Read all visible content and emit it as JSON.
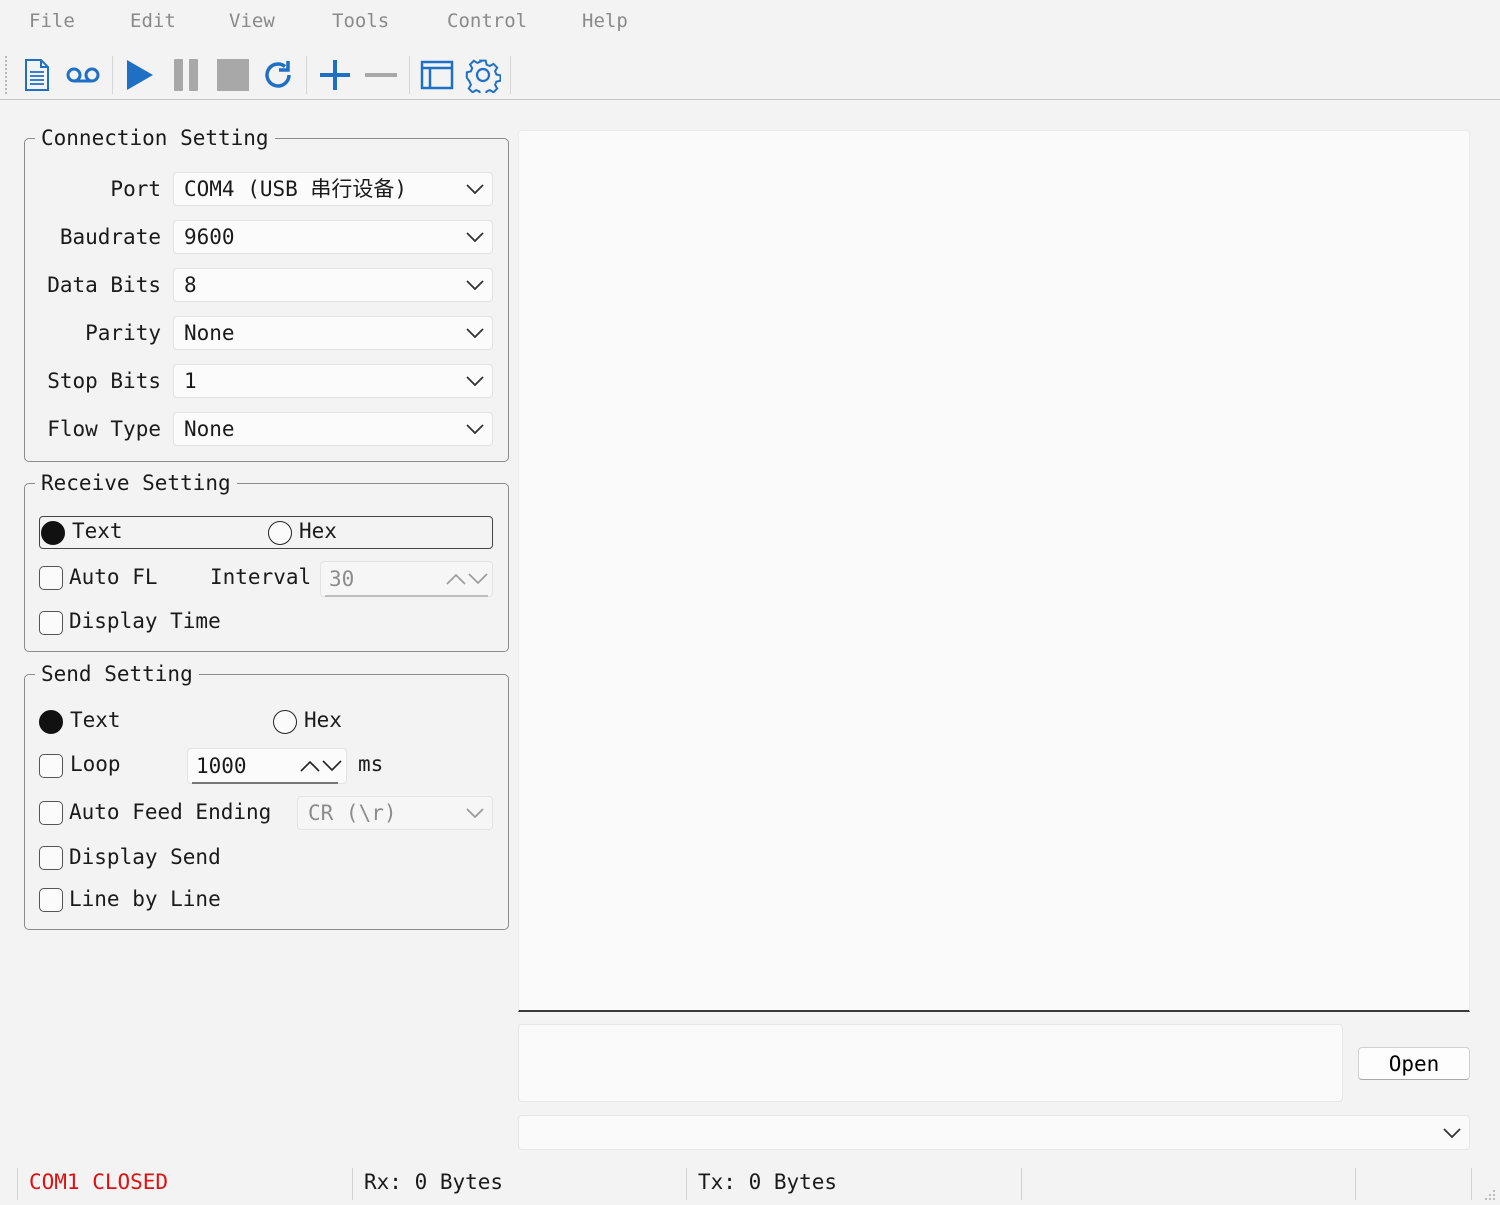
{
  "menu": [
    "File",
    "Edit",
    "View",
    "Tools",
    "Control",
    "Help"
  ],
  "toolbar": {
    "icons": [
      "new-document-icon",
      "voicemail-icon",
      "play-icon",
      "pause-icon",
      "stop-icon",
      "refresh-icon",
      "add-icon",
      "remove-icon",
      "window-icon",
      "settings-icon"
    ],
    "accent": "#1f6fc5"
  },
  "connection": {
    "title": "Connection Setting",
    "port_label": "Port",
    "port_value": "COM4 (USB 串行设备)",
    "baudrate_label": "Baudrate",
    "baudrate_value": "9600",
    "databits_label": "Data Bits",
    "databits_value": "8",
    "parity_label": "Parity",
    "parity_value": "None",
    "stopbits_label": "Stop Bits",
    "stopbits_value": "1",
    "flow_label": "Flow Type",
    "flow_value": "None"
  },
  "receive": {
    "title": "Receive Setting",
    "text_label": "Text",
    "hex_label": "Hex",
    "selected": "Text",
    "autofl_label": "Auto FL",
    "autofl_checked": false,
    "interval_label": "Interval",
    "interval_value": "30",
    "displaytime_label": "Display Time",
    "displaytime_checked": false
  },
  "send": {
    "title": "Send Setting",
    "text_label": "Text",
    "hex_label": "Hex",
    "selected": "Text",
    "loop_label": "Loop",
    "loop_checked": false,
    "loop_value": "1000",
    "loop_unit": "ms",
    "autofeed_label": "Auto Feed Ending",
    "autofeed_checked": false,
    "autofeed_value": "CR (\\r)",
    "displaysend_label": "Display Send",
    "displaysend_checked": false,
    "linebyline_label": "Line by Line",
    "linebyline_checked": false
  },
  "open_button": "Open",
  "status": {
    "port_state": "COM1 CLOSED",
    "port_state_color": "#e01010",
    "rx": "Rx: 0 Bytes",
    "tx": "Tx: 0 Bytes"
  }
}
